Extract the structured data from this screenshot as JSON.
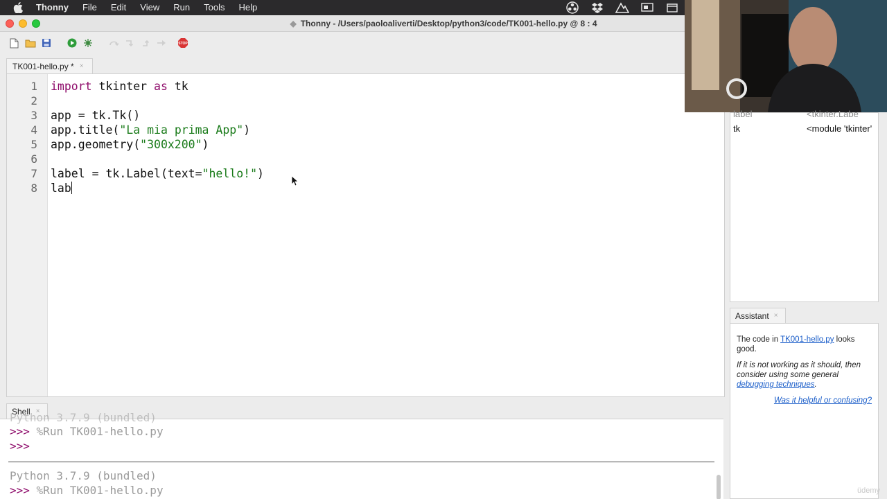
{
  "menubar": {
    "app_name": "Thonny",
    "items": [
      "File",
      "Edit",
      "View",
      "Run",
      "Tools",
      "Help"
    ]
  },
  "window": {
    "dirty_mark": "◆",
    "title": "Thonny  -  /Users/paoloaliverti/Desktop/python3/code/TK001-hello.py  @  8 : 4"
  },
  "editor": {
    "tab_label": "TK001-hello.py *",
    "tab_close": "×",
    "line_numbers": [
      "1",
      "2",
      "3",
      "4",
      "5",
      "6",
      "7",
      "8"
    ]
  },
  "variables": {
    "partial_name": "label",
    "partial_value": "<tkinter.Labe",
    "rows": [
      {
        "name": "tk",
        "value": "<module 'tkinter'"
      }
    ]
  },
  "assistant": {
    "tab_label": "Assistant",
    "tab_close": "×",
    "msg_prefix": "The code in ",
    "file_link": "TK001-hello.py",
    "msg_suffix": " looks good.",
    "hint_prefix": "If it is not working as it should, then consider using some general ",
    "hint_link": "debugging techniques",
    "hint_suffix": ".",
    "feedback_link": "Was it helpful or confusing?"
  },
  "shell": {
    "tab_label": "Shell",
    "tab_close": "×",
    "partial_top": "Python 3.7.9 (bundled)",
    "prompt": ">>>",
    "run_cmd_1": "%Run TK001-hello.py",
    "version": "Python 3.7.9 (bundled)",
    "run_cmd_2": "%Run TK001-hello.py"
  },
  "watermark": "üdemy"
}
